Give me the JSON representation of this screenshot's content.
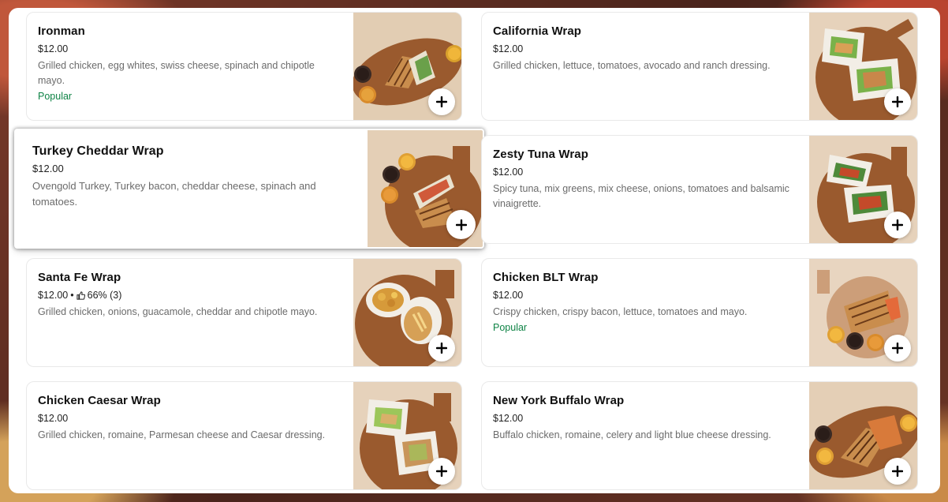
{
  "items": [
    {
      "name": "Ironman",
      "price": "$12.00",
      "rating": "",
      "description": "Grilled chicken, egg whites, swiss cheese, spinach and chipotle mayo.",
      "badge": "Popular"
    },
    {
      "name": "California Wrap",
      "price": "$12.00",
      "rating": "",
      "description": "Grilled chicken, lettuce, tomatoes, avocado and ranch dressing.",
      "badge": ""
    },
    {
      "name": "Turkey Cheddar Wrap",
      "price": "$12.00",
      "rating": "",
      "description": "Ovengold Turkey, Turkey bacon, cheddar cheese, spinach and tomatoes.",
      "badge": ""
    },
    {
      "name": "Zesty Tuna Wrap",
      "price": "$12.00",
      "rating": "",
      "description": "Spicy tuna, mix greens, mix cheese, onions, tomatoes and balsamic vinaigrette.",
      "badge": ""
    },
    {
      "name": "Santa Fe Wrap",
      "price": "$12.00",
      "rating": "66% (3)",
      "description": "Grilled chicken, onions, guacamole, cheddar and chipotle mayo.",
      "badge": ""
    },
    {
      "name": "Chicken BLT Wrap",
      "price": "$12.00",
      "rating": "",
      "description": "Crispy chicken, crispy bacon, lettuce, tomatoes and mayo.",
      "badge": "Popular"
    },
    {
      "name": "Chicken Caesar Wrap",
      "price": "$12.00",
      "rating": "",
      "description": "Grilled chicken, romaine, Parmesan cheese and Caesar dressing.",
      "badge": ""
    },
    {
      "name": "New York Buffalo Wrap",
      "price": "$12.00",
      "rating": "",
      "description": "Buffalo chicken, romaine, celery and light blue cheese dressing.",
      "badge": ""
    }
  ],
  "icons": {
    "add": "plus-icon",
    "rating": "thumbs-up-icon"
  },
  "colors": {
    "popular": "#0e8345",
    "text": "#111111",
    "muted": "#6b6b6b",
    "board": "#9a5a2e"
  }
}
